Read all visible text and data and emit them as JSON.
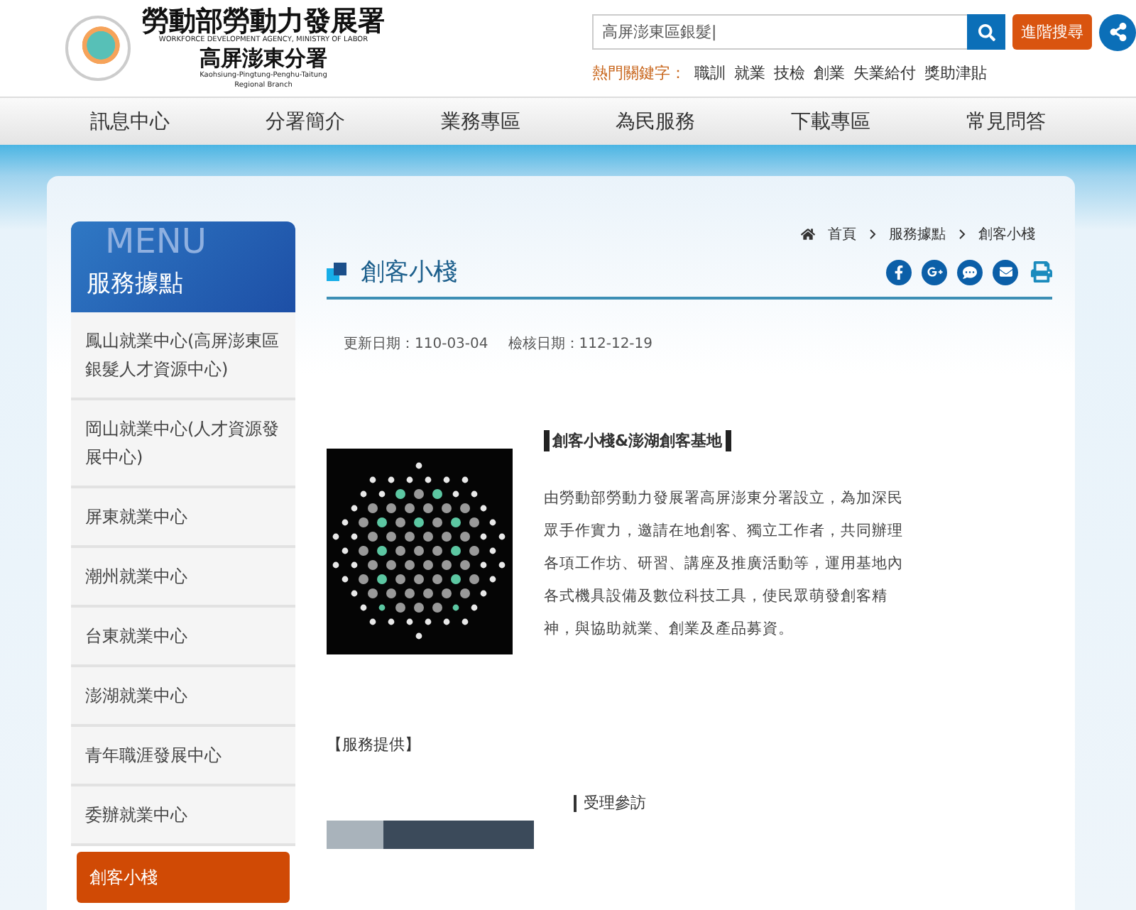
{
  "header": {
    "agency_name": "勞動部勞動力發展署",
    "agency_name_en": "WORKFORCE DEVELOPMENT AGENCY, MINISTRY OF LABOR",
    "branch_name": "高屏澎東分署",
    "branch_name_en": "Kaohsiung-Pingtung-Penghu-Taitung Regional Branch",
    "search": {
      "value": "高屏澎東區銀髮|"
    },
    "advanced_search": "進階搜尋",
    "hot_keywords_label": "熱門關鍵字：",
    "hot_keywords": [
      "職訓",
      "就業",
      "技檢",
      "創業",
      "失業給付",
      "獎助津貼"
    ]
  },
  "nav": [
    "訊息中心",
    "分署簡介",
    "業務專區",
    "為民服務",
    "下載專區",
    "常見問答"
  ],
  "sidebar": {
    "watermark": "MENU",
    "title": "服務據點",
    "items": [
      {
        "label": "鳳山就業中心(高屏澎東區銀髮人才資源中心)",
        "selected": false
      },
      {
        "label": "岡山就業中心(人才資源發展中心)",
        "selected": false
      },
      {
        "label": "屏東就業中心",
        "selected": false
      },
      {
        "label": "潮州就業中心",
        "selected": false
      },
      {
        "label": "台東就業中心",
        "selected": false
      },
      {
        "label": "澎湖就業中心",
        "selected": false
      },
      {
        "label": "青年職涯發展中心",
        "selected": false
      },
      {
        "label": "委辦就業中心",
        "selected": false
      },
      {
        "label": "創客小棧",
        "selected": true
      }
    ]
  },
  "breadcrumb": [
    "首頁",
    "服務據點",
    "創客小棧"
  ],
  "page_title": "創客小棧",
  "dates": {
    "updated": "更新日期：110-03-04",
    "reviewed": "檢核日期：112-12-19"
  },
  "article": {
    "heading": "創客小棧&澎湖創客基地",
    "body": "由勞動部勞動力發展署高屏澎東分署設立，為加深民眾手作實力，邀請在地創客、獨立工作者，共同辦理各項工作坊、研習、講座及推廣活動等，運用基地內各式機具設備及數位科技工具，使民眾萌發創客精神，與協助就業、創業及產品募資。",
    "services_heading": "【服務提供】",
    "service_item": "受理參訪"
  }
}
